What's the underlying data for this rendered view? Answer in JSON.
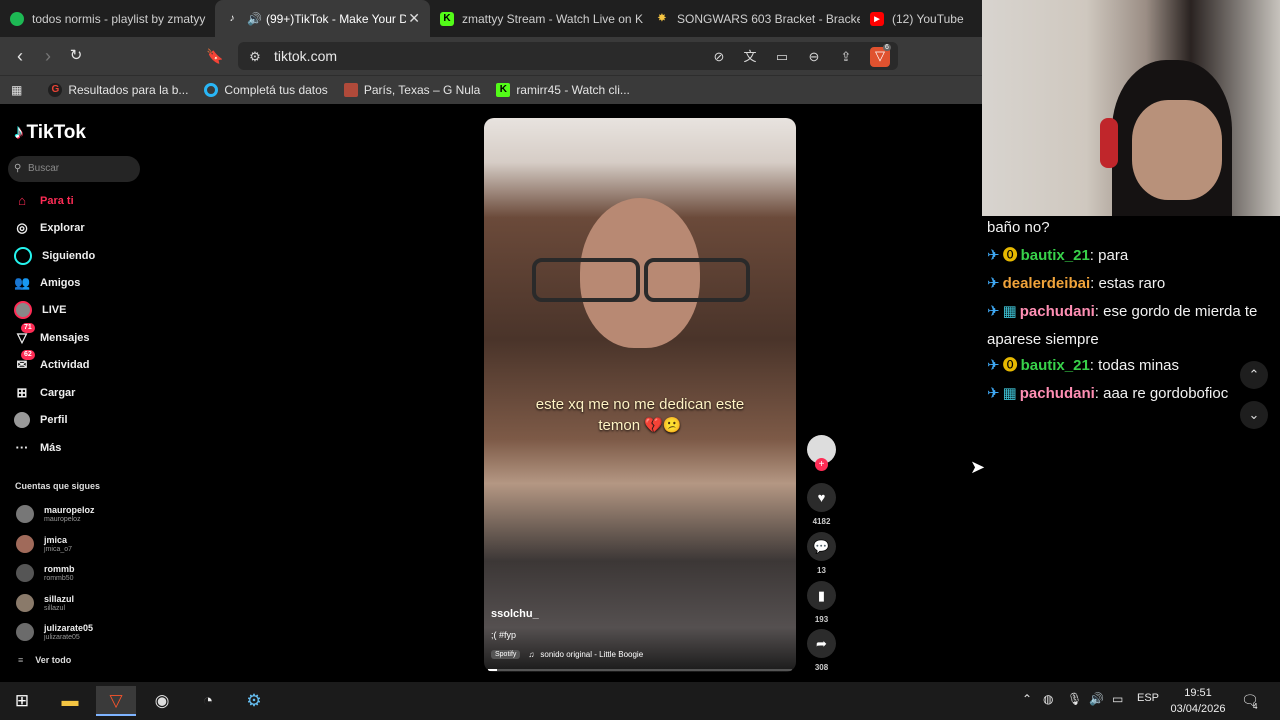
{
  "browser": {
    "tabs": [
      {
        "label": "todos normis - playlist by zmatyy",
        "icon_color": "#1db954",
        "icon": "spotify-icon",
        "active": false
      },
      {
        "label": "(99+)TikTok - Make Your D",
        "icon_color": "#ffffff",
        "icon": "tiktok-icon",
        "active": true
      },
      {
        "label": "zmattyy Stream - Watch Live on K",
        "icon_color": "#53fc18",
        "icon": "kick-icon",
        "active": false
      },
      {
        "label": "SONGWARS 603 Bracket - Bracket",
        "icon_color": "#f5c542",
        "icon": "bracket-icon",
        "active": false
      },
      {
        "label": "(12) YouTube",
        "icon_color": "#ff0000",
        "icon": "youtube-icon",
        "active": false
      }
    ],
    "url": "tiktok.com",
    "bookmarks": [
      {
        "label": "Resultados para la b...",
        "icon": "google-icon",
        "color": "#4285f4"
      },
      {
        "label": "Completá tus datos",
        "icon": "circle-icon",
        "color": "#29b6f6"
      },
      {
        "label": "París, Texas – G Nula",
        "icon": "image-icon",
        "color": "#b04a3a"
      },
      {
        "label": "ramirr45 - Watch cli...",
        "icon": "kick-icon",
        "color": "#53fc18"
      }
    ],
    "extension_badge": "6"
  },
  "tiktok": {
    "logo": "TikTok",
    "search_placeholder": "Buscar",
    "nav": [
      {
        "label": "Para ti",
        "icon": "home-icon",
        "active": true
      },
      {
        "label": "Explorar",
        "icon": "compass-icon"
      },
      {
        "label": "Siguiendo",
        "icon": "following-icon"
      },
      {
        "label": "Amigos",
        "icon": "friends-icon"
      },
      {
        "label": "LIVE",
        "icon": "live-icon"
      },
      {
        "label": "Mensajes",
        "icon": "messages-icon",
        "badge": "71"
      },
      {
        "label": "Actividad",
        "icon": "activity-icon",
        "badge": "62"
      },
      {
        "label": "Cargar",
        "icon": "upload-icon"
      },
      {
        "label": "Perfil",
        "icon": "profile-icon"
      },
      {
        "label": "Más",
        "icon": "more-icon"
      }
    ],
    "following_title": "Cuentas que sigues",
    "accounts": [
      {
        "name": "mauropeloz",
        "handle": "mauropeloz"
      },
      {
        "name": "jmica",
        "handle": "jmica_o7"
      },
      {
        "name": "rommb",
        "handle": "rommb50"
      },
      {
        "name": "sillazul",
        "handle": "sillazul"
      },
      {
        "name": "julizarate05",
        "handle": "julizarate05"
      }
    ],
    "see_all": "Ver todo",
    "video": {
      "caption_line1": "este xq me no me dedican este",
      "caption_line2": "temon 💔😕",
      "username": "ssolchu_",
      "description": ";( #fyp",
      "spotify_tag": "Spotify",
      "music": "sonido original - Little Boogie",
      "progress": 0.03
    },
    "actions": {
      "likes": "4182",
      "comments": "13",
      "saves": "193",
      "shares": "308"
    }
  },
  "stream_chat": {
    "messages": [
      {
        "user": "",
        "text": "baño no?",
        "user_class": ""
      },
      {
        "user": "bautix_21",
        "text": "para",
        "badge": "coin",
        "user_class": "u1"
      },
      {
        "user": "dealerdeibai",
        "text": "estas raro",
        "badge": "",
        "user_class": "u2"
      },
      {
        "user": "pachudani",
        "text": "ese gordo de mierda te aparese siempre",
        "badge": "grid",
        "user_class": "u3"
      },
      {
        "user": "bautix_21",
        "text": "todas minas",
        "badge": "coin",
        "user_class": "u1"
      },
      {
        "user": "pachudani",
        "text": "aaa re gordobofioc",
        "badge": "grid",
        "user_class": "u3"
      }
    ]
  },
  "taskbar": {
    "language": "ESP",
    "time": "19:51",
    "date": "03/04/2026",
    "notifications": "4"
  }
}
